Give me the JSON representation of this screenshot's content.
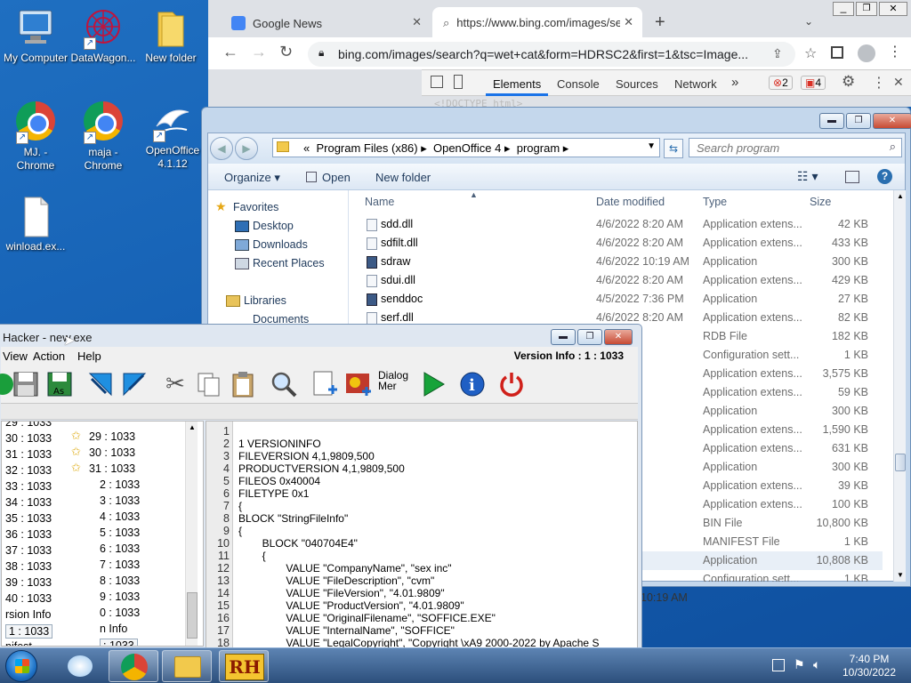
{
  "desktop": {
    "icons": [
      {
        "label": "My Computer"
      },
      {
        "label": "DataWagon..."
      },
      {
        "label": "New folder"
      },
      {
        "label": "MJ. -\nChrome"
      },
      {
        "label": "maja -\nChrome"
      },
      {
        "label": "OpenOffice\n4.1.12"
      },
      {
        "label": "winload.ex..."
      }
    ]
  },
  "chrome": {
    "tabs": [
      {
        "title": "Google News"
      },
      {
        "title": "https://www.bing.com/images/se"
      }
    ],
    "new_tab": "+",
    "url": "bing.com/images/search?q=wet+cat&form=HDRSC2&first=1&tsc=Image...",
    "devtools": {
      "tabs": [
        "Elements",
        "Console",
        "Sources",
        "Network"
      ],
      "more": "»",
      "errors": "2",
      "warnings": "4",
      "faded_source": "<!DOCTYPE html>"
    },
    "colors": {
      "tab_bar": "#dee1e6",
      "accent": "#1a73e8"
    }
  },
  "explorer": {
    "breadcrumb": [
      "«",
      "Program Files (x86)",
      "OpenOffice 4",
      "program"
    ],
    "search_placeholder": "Search program",
    "toolbar": {
      "organize": "Organize",
      "open": "Open",
      "new_folder": "New folder"
    },
    "nav": {
      "favorites": "Favorites",
      "desktop": "Desktop",
      "downloads": "Downloads",
      "recent": "Recent Places",
      "libraries": "Libraries",
      "documents": "Documents"
    },
    "columns": {
      "name": "Name",
      "date": "Date modified",
      "type": "Type",
      "size": "Size"
    },
    "files": [
      {
        "name": "sdd.dll",
        "date": "4/6/2022 8:20 AM",
        "type": "Application extens...",
        "size": "42 KB"
      },
      {
        "name": "sdfilt.dll",
        "date": "4/6/2022 8:20 AM",
        "type": "Application extens...",
        "size": "433 KB"
      },
      {
        "name": "sdraw",
        "date": "4/6/2022 10:19 AM",
        "type": "Application",
        "size": "300 KB"
      },
      {
        "name": "sdui.dll",
        "date": "4/6/2022 8:20 AM",
        "type": "Application extens...",
        "size": "429 KB"
      },
      {
        "name": "senddoc",
        "date": "4/5/2022 7:36 PM",
        "type": "Application",
        "size": "27 KB"
      },
      {
        "name": "serf.dll",
        "date": "4/6/2022 8:20 AM",
        "type": "Application extens...",
        "size": "82 KB"
      },
      {
        "name": "",
        "date": "",
        "type": "RDB File",
        "size": "182 KB"
      },
      {
        "name": "",
        "date": ":27 PM",
        "type": "Configuration sett...",
        "size": "1 KB"
      },
      {
        "name": "",
        "date": "0 AM",
        "type": "Application extens...",
        "size": "3,575 KB"
      },
      {
        "name": "",
        "date": "0 AM",
        "type": "Application extens...",
        "size": "59 KB"
      },
      {
        "name": "",
        "date": "19 AM",
        "type": "Application",
        "size": "300 KB"
      },
      {
        "name": "",
        "date": "0 AM",
        "type": "Application extens...",
        "size": "1,590 KB"
      },
      {
        "name": "",
        "date": "0 AM",
        "type": "Application extens...",
        "size": "631 KB"
      },
      {
        "name": "",
        "date": "19 AM",
        "type": "Application",
        "size": "300 KB"
      },
      {
        "name": "",
        "date": "0 AM",
        "type": "Application extens...",
        "size": "39 KB"
      },
      {
        "name": "",
        "date": "0 AM",
        "type": "Application extens...",
        "size": "100 KB"
      },
      {
        "name": "",
        "date": "19 AM",
        "type": "BIN File",
        "size": "10,800 KB"
      },
      {
        "name": "",
        "date": "0 AM",
        "type": "MANIFEST File",
        "size": "1 KB"
      },
      {
        "name": "",
        "date": "19 AM",
        "type": "Application",
        "size": "10,808 KB"
      },
      {
        "name": "",
        "date": ":27 PM",
        "type": "Configuration sett...",
        "size": "1 KB"
      }
    ],
    "status_time": "10:19 AM"
  },
  "reshacker": {
    "title": "Hacker - new.exe",
    "menu": [
      "View",
      "Action",
      "Help"
    ],
    "version_info": "Version Info : 1 : 1033",
    "dialog_label": "Dialog\nMer",
    "tree_left": [
      "29 : 1033",
      "30 : 1033",
      "31 : 1033",
      "32 : 1033",
      "33 : 1033",
      "34 : 1033",
      "35 : 1033",
      "36 : 1033",
      "37 : 1033",
      "38 : 1033",
      "39 : 1033",
      "40 : 1033",
      "rsion Info",
      "1 : 1033",
      "nifest"
    ],
    "tree_right": [
      "29 : 1033",
      "30 : 1033",
      "31 : 1033",
      "2 : 1033",
      "3 : 1033",
      "4 : 1033",
      "5 : 1033",
      "6 : 1033",
      "7 : 1033",
      "8 : 1033",
      "9 : 1033",
      "0 : 1033",
      "n Info",
      ": 1033"
    ],
    "code_lines": [
      "",
      "1 VERSIONINFO",
      "FILEVERSION 4,1,9809,500",
      "PRODUCTVERSION 4,1,9809,500",
      "FILEOS 0x40004",
      "FILETYPE 0x1",
      "{",
      "BLOCK \"StringFileInfo\"",
      "{",
      "        BLOCK \"040704E4\"",
      "        {",
      "                VALUE \"CompanyName\", \"sex inc\"",
      "                VALUE \"FileDescription\", \"cvm\"",
      "                VALUE \"FileVersion\", \"4.01.9809\"",
      "                VALUE \"ProductVersion\", \"4.01.9809\"",
      "                VALUE \"OriginalFilename\", \"SOFFICE.EXE\"",
      "                VALUE \"InternalName\", \"SOFFICE\"",
      "                VALUE \"LegalCopyright\", \"Copyright \\xA9 2000-2022 by Apache S"
    ],
    "line_numbers": [
      "1",
      "2",
      "3",
      "4",
      "5",
      "6",
      "7",
      "8",
      "9",
      "10",
      "11",
      "12",
      "13",
      "14",
      "15",
      "16",
      "17",
      "18"
    ]
  },
  "taskbar": {
    "rh_label": "RH",
    "time": "7:40 PM",
    "date": "10/30/2022"
  }
}
